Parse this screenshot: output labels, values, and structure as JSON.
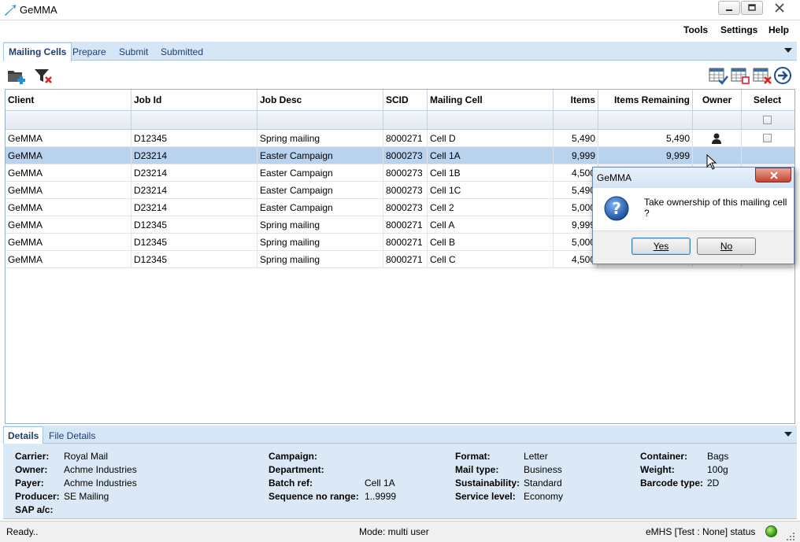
{
  "window": {
    "title": "GeMMA"
  },
  "menu": {
    "items": [
      "Tools",
      "Settings",
      "Help"
    ]
  },
  "tabs": [
    "Mailing Cells",
    "Prepare",
    "Submit",
    "Submitted"
  ],
  "grid": {
    "columns": [
      "Client",
      "Job Id",
      "Job Desc",
      "SCID",
      "Mailing Cell",
      "Items",
      "Items Remaining",
      "Owner",
      "Select"
    ],
    "rows": [
      {
        "client": "GeMMA",
        "job_id": "D12345",
        "job_desc": "Spring mailing",
        "scid": "8000271",
        "cell": "Cell D",
        "items": "5,490",
        "remaining": "5,490",
        "owner": true,
        "selected": false
      },
      {
        "client": "GeMMA",
        "job_id": "D23214",
        "job_desc": "Easter Campaign",
        "scid": "8000273",
        "cell": "Cell 1A",
        "items": "9,999",
        "remaining": "9,999",
        "owner": false,
        "selected": true
      },
      {
        "client": "GeMMA",
        "job_id": "D23214",
        "job_desc": "Easter Campaign",
        "scid": "8000273",
        "cell": "Cell 1B",
        "items": "4,500",
        "remaining": "",
        "owner": false,
        "selected": false
      },
      {
        "client": "GeMMA",
        "job_id": "D23214",
        "job_desc": "Easter Campaign",
        "scid": "8000273",
        "cell": "Cell 1C",
        "items": "5,490",
        "remaining": "",
        "owner": false,
        "selected": false
      },
      {
        "client": "GeMMA",
        "job_id": "D23214",
        "job_desc": "Easter Campaign",
        "scid": "8000273",
        "cell": "Cell 2",
        "items": "5,000",
        "remaining": "",
        "owner": false,
        "selected": false
      },
      {
        "client": "GeMMA",
        "job_id": "D12345",
        "job_desc": "Spring mailing",
        "scid": "8000271",
        "cell": "Cell A",
        "items": "9,999",
        "remaining": "",
        "owner": false,
        "selected": false
      },
      {
        "client": "GeMMA",
        "job_id": "D12345",
        "job_desc": "Spring mailing",
        "scid": "8000271",
        "cell": "Cell B",
        "items": "5,000",
        "remaining": "",
        "owner": false,
        "selected": false
      },
      {
        "client": "GeMMA",
        "job_id": "D12345",
        "job_desc": "Spring mailing",
        "scid": "8000271",
        "cell": "Cell C",
        "items": "4,500",
        "remaining": "",
        "owner": false,
        "selected": false
      }
    ]
  },
  "detail_tabs": [
    "Details",
    "File Details"
  ],
  "details": {
    "col1": [
      {
        "label": "Carrier:",
        "value": "Royal Mail"
      },
      {
        "label": "Owner:",
        "value": "Achme Industries"
      },
      {
        "label": "Payer:",
        "value": "Achme Industries"
      },
      {
        "label": "Producer:",
        "value": "SE Mailing"
      },
      {
        "label": "SAP a/c:",
        "value": ""
      }
    ],
    "col2": [
      {
        "label": "Campaign:",
        "value": ""
      },
      {
        "label": "Department:",
        "value": ""
      },
      {
        "label": "Batch ref:",
        "value": "Cell 1A"
      },
      {
        "label": "Sequence no range:",
        "value": "1..9999"
      }
    ],
    "col3": [
      {
        "label": "Format:",
        "value": "Letter"
      },
      {
        "label": "Mail type:",
        "value": "Business"
      },
      {
        "label": "Sustainability:",
        "value": "Standard"
      },
      {
        "label": "Service level:",
        "value": "Economy"
      }
    ],
    "col4": [
      {
        "label": "Container:",
        "value": "Bags"
      },
      {
        "label": "Weight:",
        "value": "100g"
      },
      {
        "label": "Barcode type:",
        "value": "2D"
      }
    ]
  },
  "status": {
    "left": "Ready..",
    "mode": "Mode: multi user",
    "env": "eMHS [Test : None] status"
  },
  "dialog": {
    "title": "GeMMA",
    "message": "Take ownership of this mailing cell ?",
    "yes": "Yes",
    "no": "No"
  },
  "colors": {
    "tab_bg": "#d5e6f7",
    "selected_row": "#b9d3ee",
    "details_bg": "#dbe9f6",
    "status_led": "#3aa315"
  }
}
